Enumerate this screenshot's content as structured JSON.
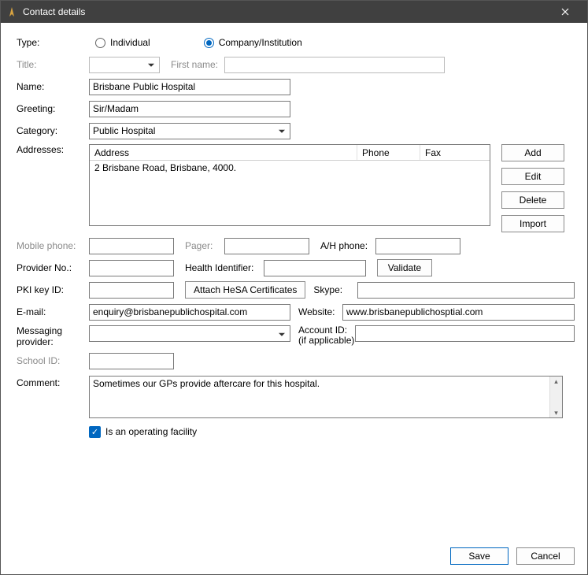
{
  "window": {
    "title": "Contact details"
  },
  "labels": {
    "type": "Type:",
    "individual": "Individual",
    "company": "Company/Institution",
    "title": "Title:",
    "firstname": "First name:",
    "name": "Name:",
    "greeting": "Greeting:",
    "category": "Category:",
    "addresses": "Addresses:",
    "addr_col": "Address",
    "phone_col": "Phone",
    "fax_col": "Fax",
    "mobile": "Mobile phone:",
    "pager": "Pager:",
    "ahphone": "A/H phone:",
    "provider": "Provider No.:",
    "health_id": "Health Identifier:",
    "validate": "Validate",
    "pki": "PKI key ID:",
    "attach_hesa": "Attach HeSA Certificates",
    "skype": "Skype:",
    "email": "E-mail:",
    "website": "Website:",
    "msg_provider": "Messaging provider:",
    "account": "Account ID: (if applicable)",
    "school": "School ID:",
    "comment": "Comment:",
    "operating": "Is an operating facility"
  },
  "buttons": {
    "add": "Add",
    "edit": "Edit",
    "delete": "Delete",
    "import": "Import",
    "save": "Save",
    "cancel": "Cancel"
  },
  "values": {
    "type_selected": "company",
    "name": "Brisbane Public Hospital",
    "greeting": "Sir/Madam",
    "category": "Public Hospital",
    "addresses": [
      {
        "address": "2 Brisbane Road, Brisbane, 4000.",
        "phone": "",
        "fax": ""
      }
    ],
    "mobile": "",
    "pager": "",
    "ahphone": "",
    "provider": "",
    "health_id": "",
    "pki": "",
    "skype": "",
    "email": "enquiry@brisbanepublichospital.com",
    "website": "www.brisbanepublichosptial.com",
    "msg_provider": "",
    "account": "",
    "school": "",
    "comment": "Sometimes our GPs provide aftercare for this hospital.",
    "operating": true
  }
}
